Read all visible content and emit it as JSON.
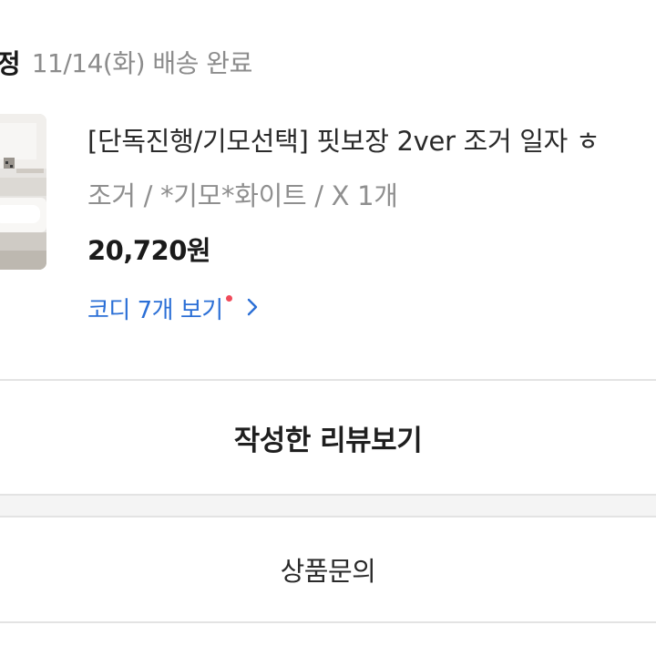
{
  "order": {
    "status_label": "정",
    "delivery_status": "11/14(화) 배송 완료"
  },
  "product": {
    "name": "[단독진행/기모선택] 핏보장 2ver 조거 일자 ㅎ",
    "option": "조거 / *기모*화이트 / X 1개",
    "price": "20,720원",
    "codi_link": "코디 7개 보기"
  },
  "actions": {
    "review_label": "작성한 리뷰보기",
    "inquiry_label": "상품문의"
  },
  "colors": {
    "link_blue": "#2b6fd6",
    "notification_dot": "#f04a5a",
    "muted_text": "#8f8f8f"
  },
  "icons": {
    "codi_chevron": "chevron-right-icon"
  }
}
